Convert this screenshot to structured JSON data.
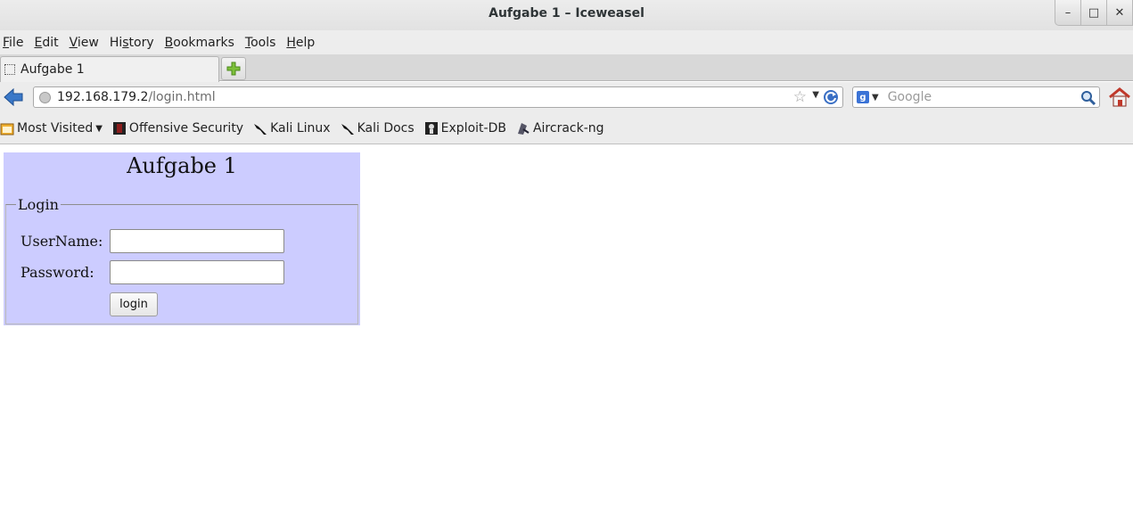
{
  "window": {
    "title": "Aufgabe 1 – Iceweasel",
    "minimize": "–",
    "maximize": "□",
    "close": "✕"
  },
  "menubar": {
    "items": [
      {
        "label": "File",
        "mnemonic": "F",
        "rest": "ile"
      },
      {
        "label": "Edit",
        "mnemonic": "E",
        "rest": "dit"
      },
      {
        "label": "View",
        "mnemonic": "V",
        "rest": "iew"
      },
      {
        "label": "History",
        "mnemonic": "",
        "pre": "Hi",
        "mn2": "s",
        "post": "tory"
      },
      {
        "label": "Bookmarks",
        "mnemonic": "B",
        "rest": "ookmarks"
      },
      {
        "label": "Tools",
        "mnemonic": "T",
        "rest": "ools"
      },
      {
        "label": "Help",
        "mnemonic": "H",
        "rest": "elp"
      }
    ]
  },
  "tabs": [
    {
      "label": "Aufgabe 1",
      "active": true
    }
  ],
  "navbar": {
    "url_host": "192.168.179.2",
    "url_path": "/login.html",
    "search_placeholder": "Google",
    "search_engine_icon": "google-icon"
  },
  "bookmarks": [
    {
      "label": "Most Visited",
      "icon": "most-visited-icon"
    },
    {
      "label": "Offensive Security",
      "icon": "offsec-icon"
    },
    {
      "label": "Kali Linux",
      "icon": "kali-dragon-icon"
    },
    {
      "label": "Kali Docs",
      "icon": "kali-dragon-icon"
    },
    {
      "label": "Exploit-DB",
      "icon": "exploitdb-icon"
    },
    {
      "label": "Aircrack-ng",
      "icon": "aircrack-icon"
    }
  ],
  "page": {
    "heading": "Aufgabe 1",
    "legend": "Login",
    "username_label": "UserName:",
    "username_value": "",
    "password_label": "Password:",
    "password_value": "",
    "login_button": "login",
    "box_color": "#ccccff"
  }
}
